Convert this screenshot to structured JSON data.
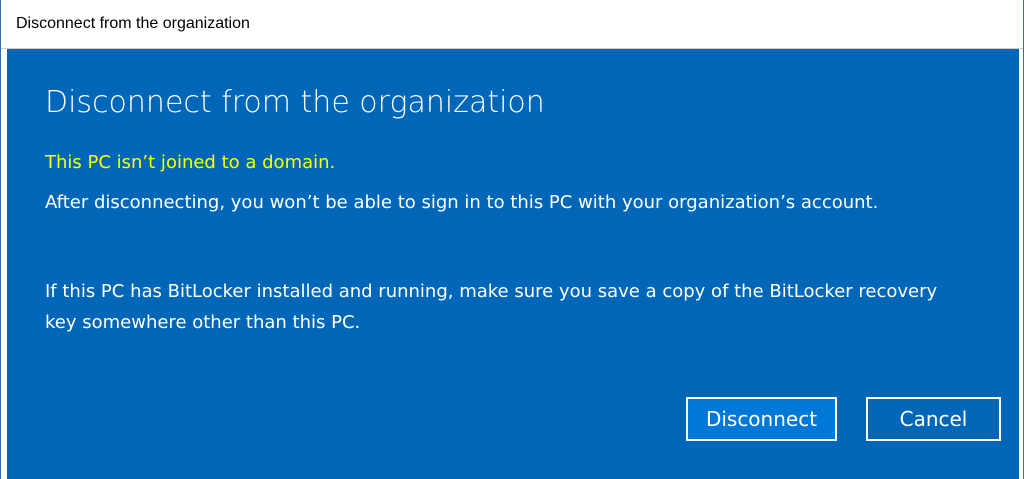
{
  "window": {
    "title": "Disconnect from the organization"
  },
  "dialog": {
    "heading": "Disconnect from the organization",
    "warning": "This PC isn’t joined to a domain.",
    "paragraph_1": "After disconnecting, you won’t be able to sign in to this PC with your organization’s account.",
    "paragraph_2": "If this PC has BitLocker installed and running, make sure you save a copy of the BitLocker recovery key somewhere other than this PC."
  },
  "buttons": {
    "disconnect_label": "Disconnect",
    "cancel_label": "Cancel"
  },
  "colors": {
    "dialog_background": "#0067b8",
    "primary_button": "#0078d7",
    "warning_text": "#ffff00"
  }
}
